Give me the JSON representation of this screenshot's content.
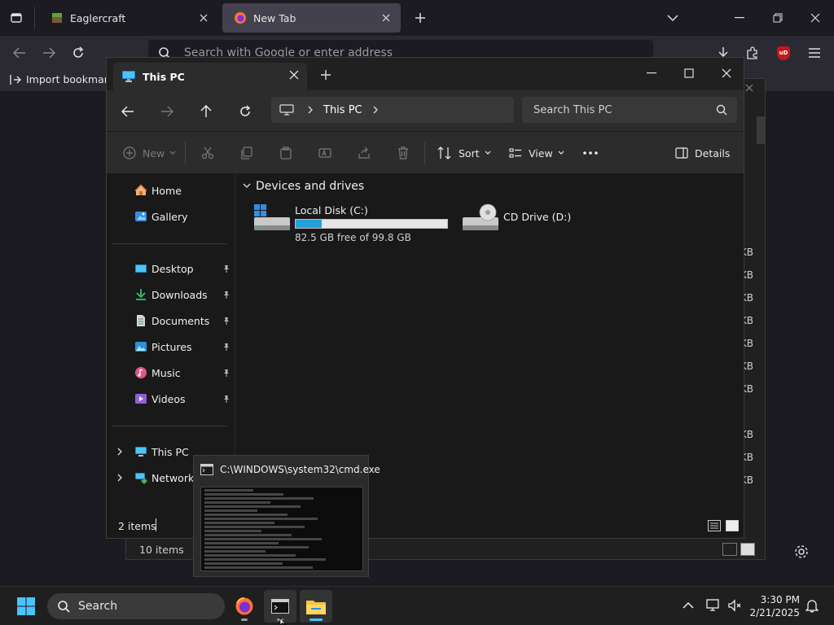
{
  "firefox": {
    "tabs": [
      {
        "title": "Eaglercraft"
      },
      {
        "title": "New Tab"
      }
    ],
    "urlbar": {
      "placeholder": "Search with Google or enter address"
    },
    "bookmarks": {
      "import_label": "Import bookmarks..."
    },
    "ublock_badge": "uD"
  },
  "background_explorer": {
    "sizes": [
      "KB",
      "KB",
      "KB",
      "KB",
      "KB",
      "KB",
      "KB",
      "KB",
      "KB",
      "KB"
    ],
    "status": "10 items"
  },
  "explorer": {
    "tab_title": "This PC",
    "breadcrumb": [
      "This PC"
    ],
    "search_placeholder": "Search This PC",
    "toolbar": {
      "new_label": "New",
      "sort_label": "Sort",
      "view_label": "View",
      "details_label": "Details"
    },
    "sidebar": {
      "top": [
        {
          "label": "Home",
          "icon": "home-icon"
        },
        {
          "label": "Gallery",
          "icon": "gallery-icon"
        }
      ],
      "pinned": [
        {
          "label": "Desktop",
          "icon": "desktop-icon"
        },
        {
          "label": "Downloads",
          "icon": "downloads-icon"
        },
        {
          "label": "Documents",
          "icon": "documents-icon"
        },
        {
          "label": "Pictures",
          "icon": "pictures-icon"
        },
        {
          "label": "Music",
          "icon": "music-icon"
        },
        {
          "label": "Videos",
          "icon": "videos-icon"
        }
      ],
      "tree": [
        {
          "label": "This PC",
          "icon": "this-pc-icon"
        },
        {
          "label": "Network",
          "icon": "network-icon"
        }
      ]
    },
    "group_header": "Devices and drives",
    "drives": [
      {
        "name": "Local Disk (C:)",
        "free_text": "82.5 GB free of 99.8 GB",
        "used_fraction": 0.173
      },
      {
        "name": "CD Drive (D:)"
      }
    ],
    "status": "2 items"
  },
  "cmd_preview": {
    "title": "C:\\WINDOWS\\system32\\cmd.exe"
  },
  "taskbar": {
    "search_label": "Search",
    "time": "3:30 PM",
    "date": "2/21/2025"
  },
  "colors": {
    "accent": "#4cc2ff",
    "drive_fill": "#26a0da",
    "ublock": "#c5161d"
  }
}
